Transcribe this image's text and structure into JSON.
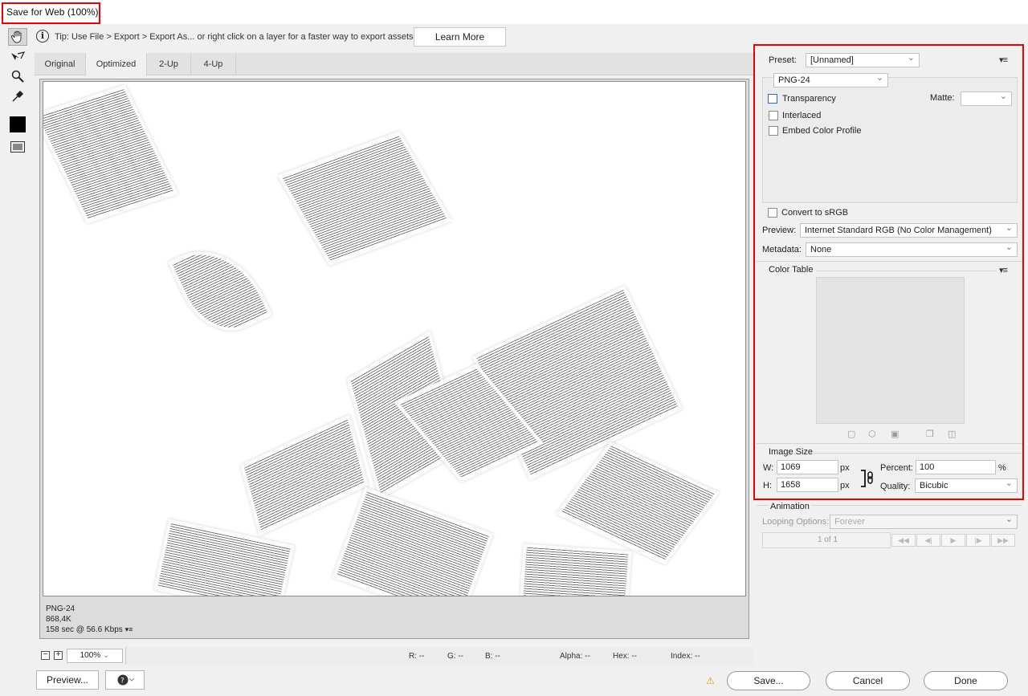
{
  "window": {
    "title": "Save for Web (100%)"
  },
  "tip": {
    "text": "Tip: Use File > Export > Export As...  or right click on a layer for a faster way to export assets",
    "learn_more": "Learn More"
  },
  "tools": [
    "hand-icon",
    "slice-select-icon",
    "zoom-icon",
    "eyedropper-icon",
    "color-swatch",
    "toggle-slices-icon"
  ],
  "tabs": [
    {
      "label": "Original"
    },
    {
      "label": "Optimized"
    },
    {
      "label": "2-Up"
    },
    {
      "label": "4-Up"
    }
  ],
  "preview": {
    "format": "PNG-24",
    "size": "868,4K",
    "time": "158 sec @ 56.6 Kbps"
  },
  "zoombar": {
    "zoom": "100%",
    "r": "R: --",
    "g": "G: --",
    "b": "B: --",
    "alpha": "Alpha: --",
    "hex": "Hex: --",
    "index": "Index: --"
  },
  "panel": {
    "preset_label": "Preset:",
    "preset_value": "[Unnamed]",
    "format_value": "PNG-24",
    "transparency": "Transparency",
    "matte": "Matte:",
    "interlaced": "Interlaced",
    "embed_profile": "Embed Color Profile",
    "convert_srgb": "Convert to sRGB",
    "preview_label": "Preview:",
    "preview_value": "Internet Standard RGB (No Color Management)",
    "metadata_label": "Metadata:",
    "metadata_value": "None",
    "color_table": "Color Table",
    "image_size": "Image Size",
    "w_label": "W:",
    "w_value": "1069",
    "h_label": "H:",
    "h_value": "1658",
    "px": "px",
    "percent_label": "Percent:",
    "percent_value": "100",
    "pct": "%",
    "quality_label": "Quality:",
    "quality_value": "Bicubic",
    "animation": "Animation",
    "looping_label": "Looping Options:",
    "looping_value": "Forever",
    "frame_counter": "1 of 1"
  },
  "buttons": {
    "preview": "Preview...",
    "save": "Save...",
    "cancel": "Cancel",
    "done": "Done"
  }
}
